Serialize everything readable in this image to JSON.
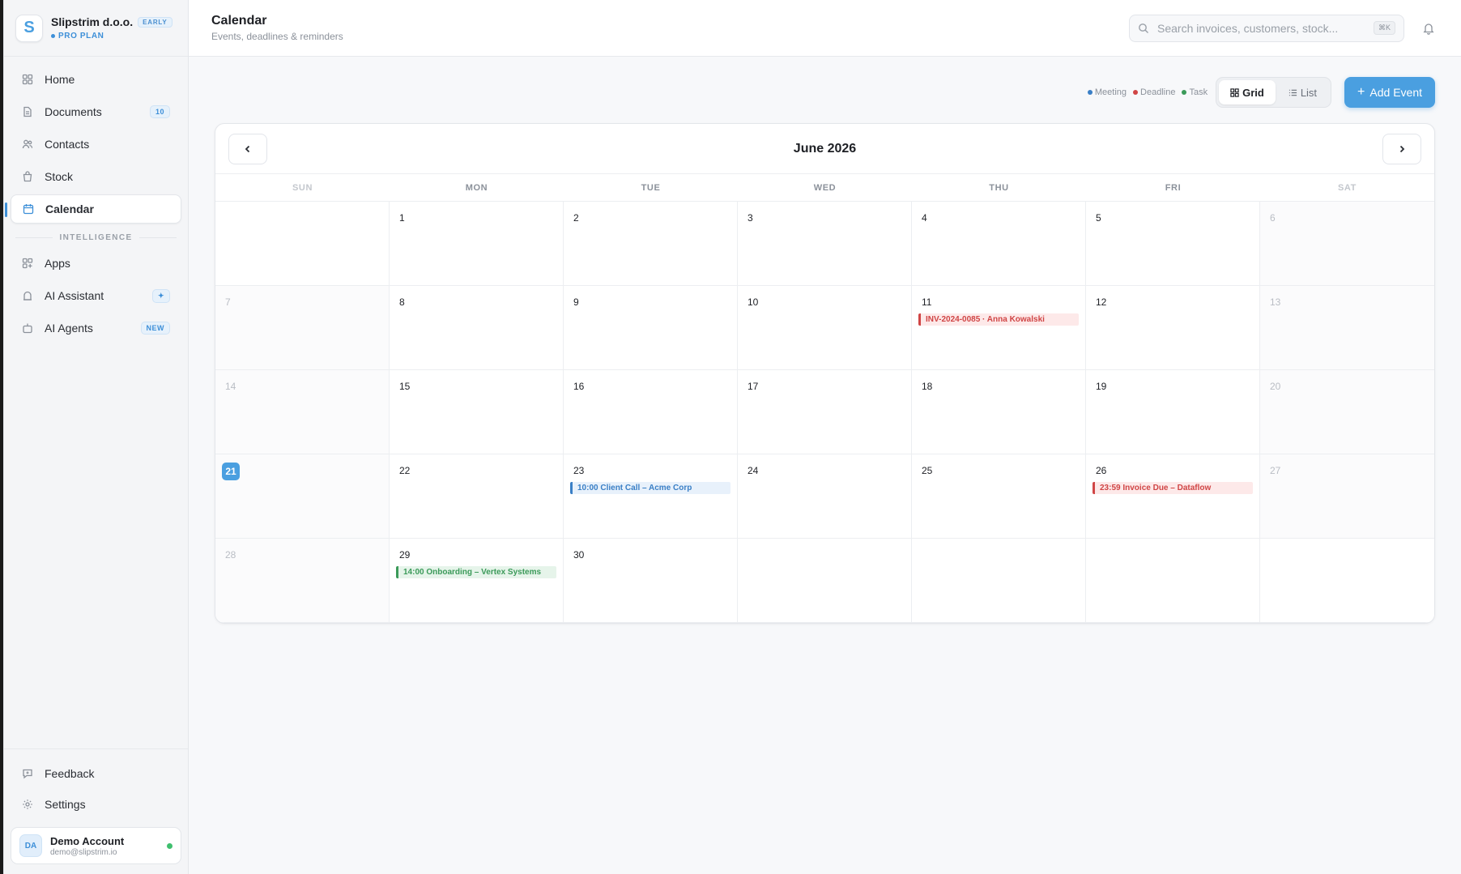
{
  "org": {
    "logo_letter": "S",
    "name": "Slipstrim d.o.o.",
    "tag": "EARLY",
    "plan": "PRO PLAN"
  },
  "sidebar": {
    "items": [
      {
        "label": "Home",
        "icon": "home-icon"
      },
      {
        "label": "Documents",
        "icon": "document-icon",
        "badge": "10"
      },
      {
        "label": "Contacts",
        "icon": "contacts-icon"
      },
      {
        "label": "Stock",
        "icon": "stock-icon"
      },
      {
        "label": "Calendar",
        "icon": "calendar-icon",
        "active": true
      }
    ],
    "section_label": "INTELLIGENCE",
    "intel_items": [
      {
        "label": "Apps",
        "icon": "apps-icon"
      },
      {
        "label": "AI Assistant",
        "icon": "ai-assistant-icon",
        "badge": "✦"
      },
      {
        "label": "AI Agents",
        "icon": "ai-agents-icon",
        "badge": "NEW"
      }
    ],
    "bottom_items": [
      {
        "label": "Feedback",
        "icon": "feedback-icon"
      },
      {
        "label": "Settings",
        "icon": "gear-icon"
      }
    ]
  },
  "user": {
    "initials": "DA",
    "name": "Demo Account",
    "email": "demo@slipstrim.io"
  },
  "header": {
    "title": "Calendar",
    "subtitle": "Events, deadlines & reminders",
    "search_placeholder": "Search invoices, customers, stock...",
    "search_shortcut": "⌘K"
  },
  "toolbar": {
    "legend": [
      {
        "label": "Meeting",
        "color": "#3a7fc6"
      },
      {
        "label": "Deadline",
        "color": "#d04545"
      },
      {
        "label": "Task",
        "color": "#3b9a59"
      }
    ],
    "grid_label": "Grid",
    "list_label": "List",
    "add_label": "Add Event"
  },
  "calendar": {
    "month_title": "June 2026",
    "weekdays": [
      "SUN",
      "MON",
      "TUE",
      "WED",
      "THU",
      "FRI",
      "SAT"
    ],
    "first_weekday_index": 1,
    "days_in_month": 30,
    "today": 21,
    "events": [
      {
        "day": 11,
        "type": "deadline",
        "text": "INV-2024-0085 · Anna Kowalski"
      },
      {
        "day": 23,
        "type": "meeting",
        "text": "10:00 Client Call – Acme Corp"
      },
      {
        "day": 26,
        "type": "deadline",
        "text": "23:59 Invoice Due – Dataflow"
      },
      {
        "day": 29,
        "type": "task",
        "text": "14:00 Onboarding – Vertex Systems"
      }
    ]
  }
}
